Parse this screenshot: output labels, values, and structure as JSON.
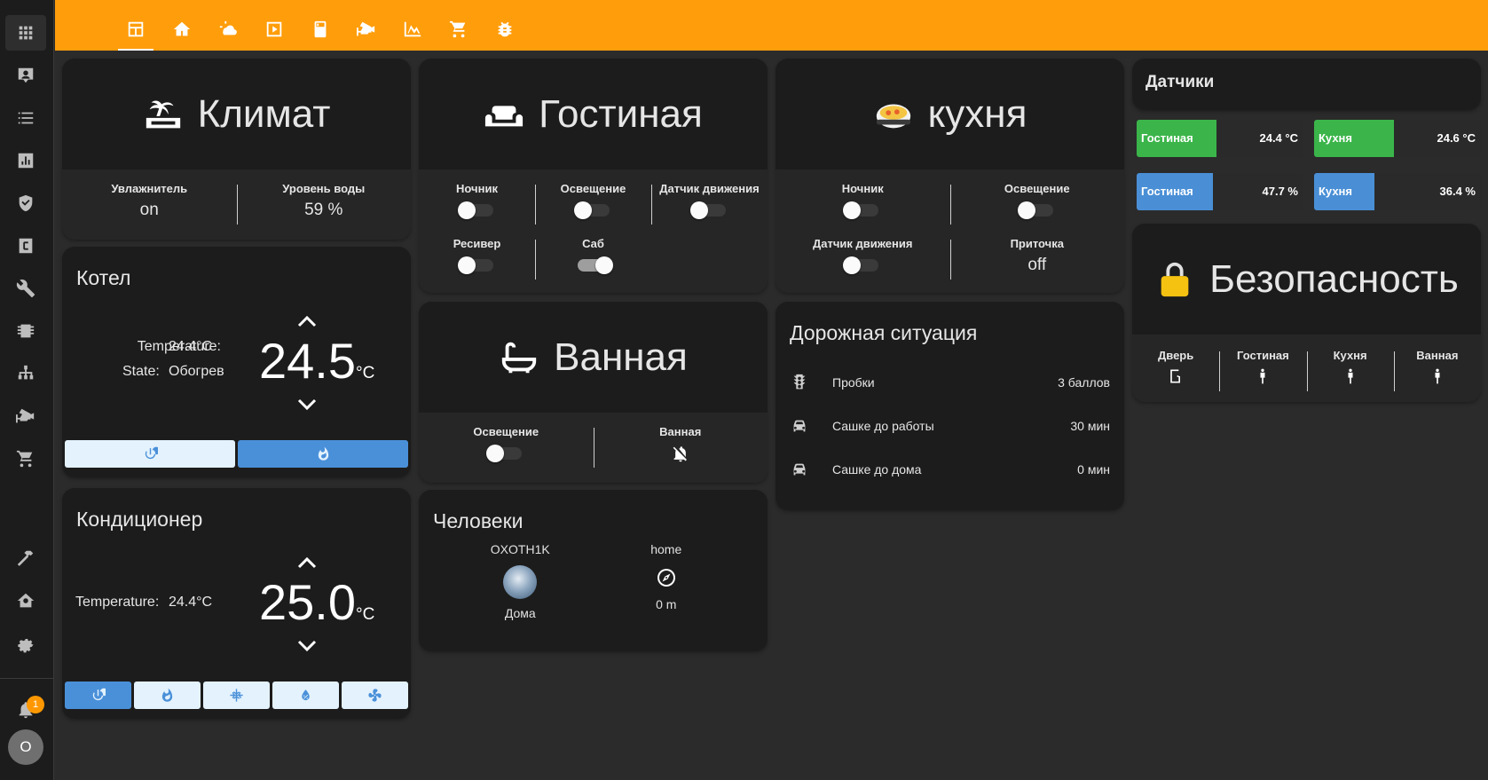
{
  "colors": {
    "accent": "#ff9d0b",
    "card": "#1c1c1c",
    "bg": "#2b2b2b",
    "green": "#3bb54a",
    "blue": "#4a8fd6",
    "mode_active": "#4a90d9",
    "mode_idle": "#e3f2fd"
  },
  "sidebar": {
    "items": [
      {
        "icon": "apps-icon"
      },
      {
        "icon": "account-box-icon"
      },
      {
        "icon": "list-icon"
      },
      {
        "icon": "chart-box-icon"
      },
      {
        "icon": "shield-icon"
      },
      {
        "icon": "alpha-c-box-icon"
      },
      {
        "icon": "wrench-icon"
      },
      {
        "icon": "memory-chip-icon"
      },
      {
        "icon": "network-icon"
      },
      {
        "icon": "cctv-icon"
      },
      {
        "icon": "cart-icon"
      },
      {
        "icon": "hammer-icon"
      },
      {
        "icon": "home-gear-icon"
      },
      {
        "icon": "cog-icon"
      }
    ],
    "notification_count": "1",
    "user_initial": "O"
  },
  "topbar": {
    "tabs": [
      {
        "icon": "view-dashboard-icon",
        "active": true
      },
      {
        "icon": "home-thermometer-icon"
      },
      {
        "icon": "weather-icon"
      },
      {
        "icon": "play-box-icon"
      },
      {
        "icon": "fridge-icon"
      },
      {
        "icon": "cctv-icon"
      },
      {
        "icon": "chart-line-icon"
      },
      {
        "icon": "cart-icon"
      },
      {
        "icon": "bug-icon"
      }
    ]
  },
  "klimat": {
    "title": "Климат",
    "items": [
      {
        "name": "Увлажнитель",
        "value": "on"
      },
      {
        "name": "Уровень воды",
        "value": "59 %"
      }
    ]
  },
  "kotel": {
    "title": "Котел",
    "temp_label": "Temperature:",
    "temp_value": "24.4°C",
    "state_label": "State:",
    "state_value": "Обогрев",
    "setpoint": "24.5",
    "unit": "°C",
    "modes": [
      {
        "icon": "power-icon",
        "active": false
      },
      {
        "icon": "fire-icon",
        "active": true
      }
    ]
  },
  "konditsioner": {
    "title": "Кондиционер",
    "temp_label": "Temperature:",
    "temp_value": "24.4°C",
    "setpoint": "25.0",
    "unit": "°C",
    "modes": [
      {
        "icon": "power-icon",
        "active": true
      },
      {
        "icon": "fire-icon",
        "active": false
      },
      {
        "icon": "snowflake-icon",
        "active": false
      },
      {
        "icon": "water-percent-icon",
        "active": false
      },
      {
        "icon": "fan-icon",
        "active": false
      }
    ]
  },
  "gostinaya": {
    "title": "Гостиная",
    "row1": [
      {
        "name": "Ночник",
        "state": "off"
      },
      {
        "name": "Освещение",
        "state": "off"
      },
      {
        "name": "Датчик движения",
        "state": "off"
      }
    ],
    "row2": [
      {
        "name": "Ресивер",
        "state": "off"
      },
      {
        "name": "Саб",
        "state": "on"
      }
    ]
  },
  "kukhnya": {
    "title": "кухня",
    "row1": [
      {
        "name": "Ночник",
        "state": "off"
      },
      {
        "name": "Освещение",
        "state": "off"
      }
    ],
    "row2": [
      {
        "name": "Датчик движения",
        "state": "off"
      },
      {
        "name": "Приточка",
        "value": "off"
      }
    ]
  },
  "vannaya": {
    "title": "Ванная",
    "items": [
      {
        "name": "Освещение",
        "state": "off"
      },
      {
        "name": "Ванная",
        "icon": "bell-off-icon"
      }
    ]
  },
  "doroga": {
    "title": "Дорожная ситуация",
    "rows": [
      {
        "icon": "traffic-light-icon",
        "name": "Пробки",
        "value": "3 баллов"
      },
      {
        "icon": "car-icon",
        "name": "Сашке до работы",
        "value": "30 мин"
      },
      {
        "icon": "car-icon",
        "name": "Сашке до дома",
        "value": "0 мин"
      }
    ]
  },
  "lyudi": {
    "title": "Человеки",
    "people": [
      {
        "name": "OXOTH1K",
        "state": "Дома"
      },
      {
        "name": "home",
        "state": "0 m"
      }
    ]
  },
  "datchiki": {
    "title": "Датчики",
    "bars": [
      {
        "label": "Гостиная",
        "value": "24.4 °C",
        "fill": 0.48,
        "color": "#3bb54a"
      },
      {
        "label": "Кухня",
        "value": "24.6 °C",
        "fill": 0.48,
        "color": "#3bb54a"
      },
      {
        "label": "Гостиная",
        "value": "47.7 %",
        "fill": 0.46,
        "color": "#4a8fd6"
      },
      {
        "label": "Кухня",
        "value": "36.4 %",
        "fill": 0.36,
        "color": "#4a8fd6"
      }
    ]
  },
  "bezopasnost": {
    "title": "Безопасность",
    "items": [
      {
        "name": "Дверь",
        "icon": "door-icon"
      },
      {
        "name": "Гостиная",
        "icon": "human-icon"
      },
      {
        "name": "Кухня",
        "icon": "human-icon"
      },
      {
        "name": "Ванная",
        "icon": "human-icon"
      }
    ]
  }
}
